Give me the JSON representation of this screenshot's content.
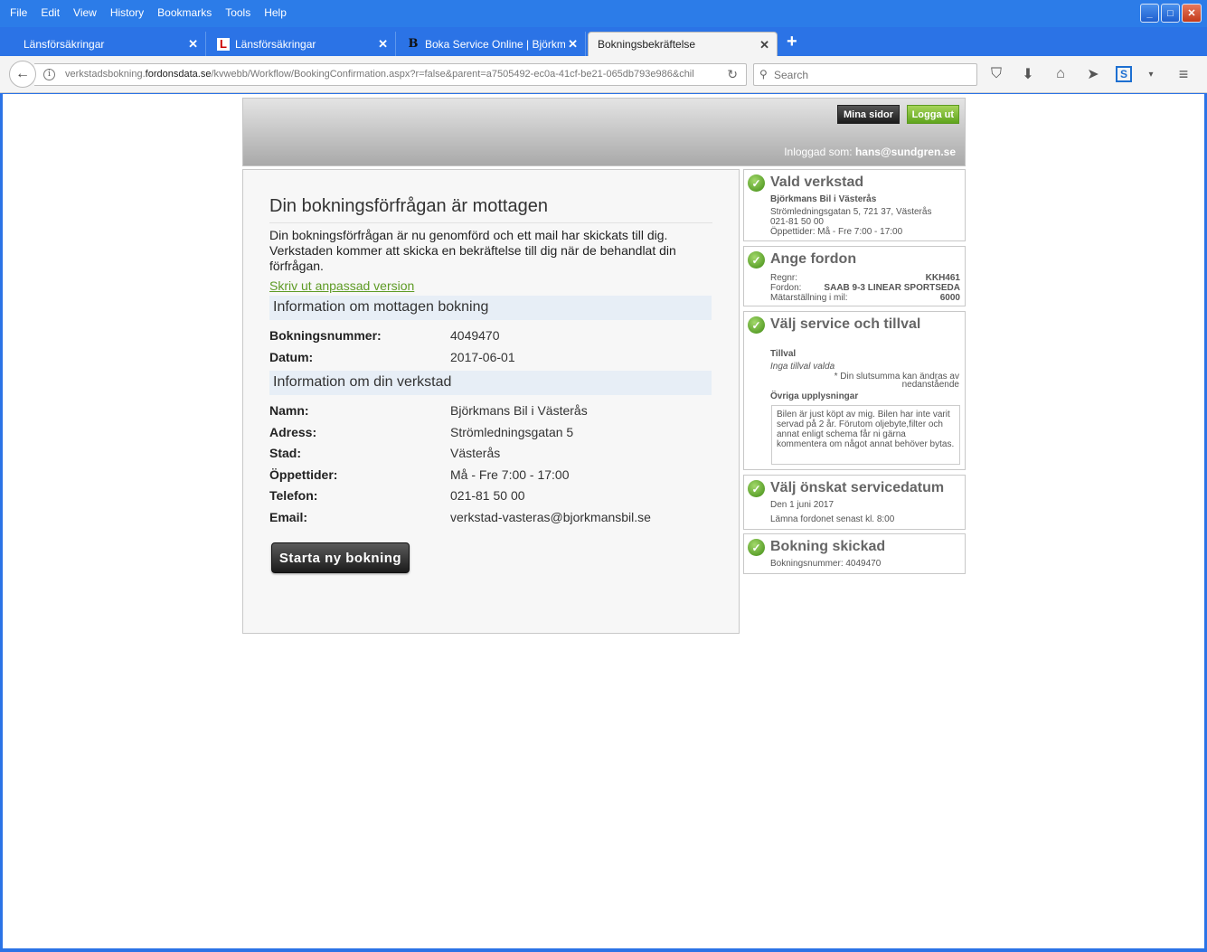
{
  "menubar": {
    "items": [
      "File",
      "Edit",
      "View",
      "History",
      "Bookmarks",
      "Tools",
      "Help"
    ]
  },
  "tabs": [
    {
      "label": "Länsförsäkringar",
      "close": "✕"
    },
    {
      "label": "Länsförsäkringar",
      "close": "✕"
    },
    {
      "label": "Boka Service Online | Björkma...",
      "close": "✕"
    },
    {
      "label": "Bokningsbekräftelse",
      "close": "✕"
    }
  ],
  "new_tab_label": "+",
  "url": {
    "prefix": "verkstadsbokning.",
    "domain": "fordonsdata.se",
    "path": "/kvwebb/Workflow/BookingConfirmation.aspx?r=false&parent=a7505492-ec0a-41cf-be21-065db793e986&chil"
  },
  "search": {
    "placeholder": "Search"
  },
  "header": {
    "mina_sidor": "Mina sidor",
    "logga_ut": "Logga ut",
    "logged_in_prefix": "Inloggad som:",
    "logged_in_user": "hans@sundgren.se"
  },
  "main": {
    "title": "Din bokningsförfrågan är mottagen",
    "text": "Din bokningsförfrågan är nu genomförd och ett mail har skickats till dig. Verkstaden kommer att skicka en bekräftelse till dig när de behandlat din förfrågan.",
    "print_link": "Skriv ut anpassad version",
    "section1": "Information om mottagen bokning",
    "booking_rows": [
      {
        "label": "Bokningsnummer:",
        "value": "4049470"
      },
      {
        "label": "Datum:",
        "value": "2017-06-01"
      }
    ],
    "section2": "Information om din verkstad",
    "workshop_rows": [
      {
        "label": "Namn:",
        "value": "Björkmans Bil i Västerås"
      },
      {
        "label": "Adress:",
        "value": "Strömledningsgatan 5"
      },
      {
        "label": "Stad:",
        "value": "Västerås"
      },
      {
        "label": "Öppettider:",
        "value": "Må - Fre 7:00 - 17:00"
      },
      {
        "label": "Telefon:",
        "value": "021-81 50 00"
      },
      {
        "label": "Email:",
        "value": "verkstad-vasteras@bjorkmansbil.se"
      }
    ],
    "new_booking_button": "Starta ny bokning"
  },
  "sidebar": {
    "workshop": {
      "title": "Vald verkstad",
      "name": "Björkmans Bil i Västerås",
      "address": "Strömledningsgatan 5, 721 37, Västerås",
      "phone": "021-81 50 00",
      "hours": "Öppettider: Må - Fre 7:00 - 17:00"
    },
    "vehicle": {
      "title": "Ange fordon",
      "rows": [
        {
          "k": "Regnr:",
          "v": "KKH461"
        },
        {
          "k": "Fordon:",
          "v": "SAAB 9-3 LINEAR SPORTSEDA"
        },
        {
          "k": "Mätarställning i mil:",
          "v": "6000"
        }
      ]
    },
    "service": {
      "title": "Välj service och tillval",
      "tillval_label": "Tillval",
      "tillval_value": "Inga tillval valda",
      "note_line1": "* Din slutsumma kan ändras av",
      "note_line2": "nedanstående",
      "upplysningar_label": "Övriga upplysningar",
      "upplysningar_text": "Bilen är just köpt av mig. Bilen har inte varit servad på 2 år. Förutom oljebyte,filter och annat enligt schema får ni gärna kommentera om något annat behöver bytas."
    },
    "date": {
      "title": "Välj önskat servicedatum",
      "date": "Den 1 juni 2017",
      "note": "Lämna fordonet senast kl. 8:00"
    },
    "sent": {
      "title": "Bokning skickad",
      "number": "Bokningsnummer: 4049470"
    }
  }
}
